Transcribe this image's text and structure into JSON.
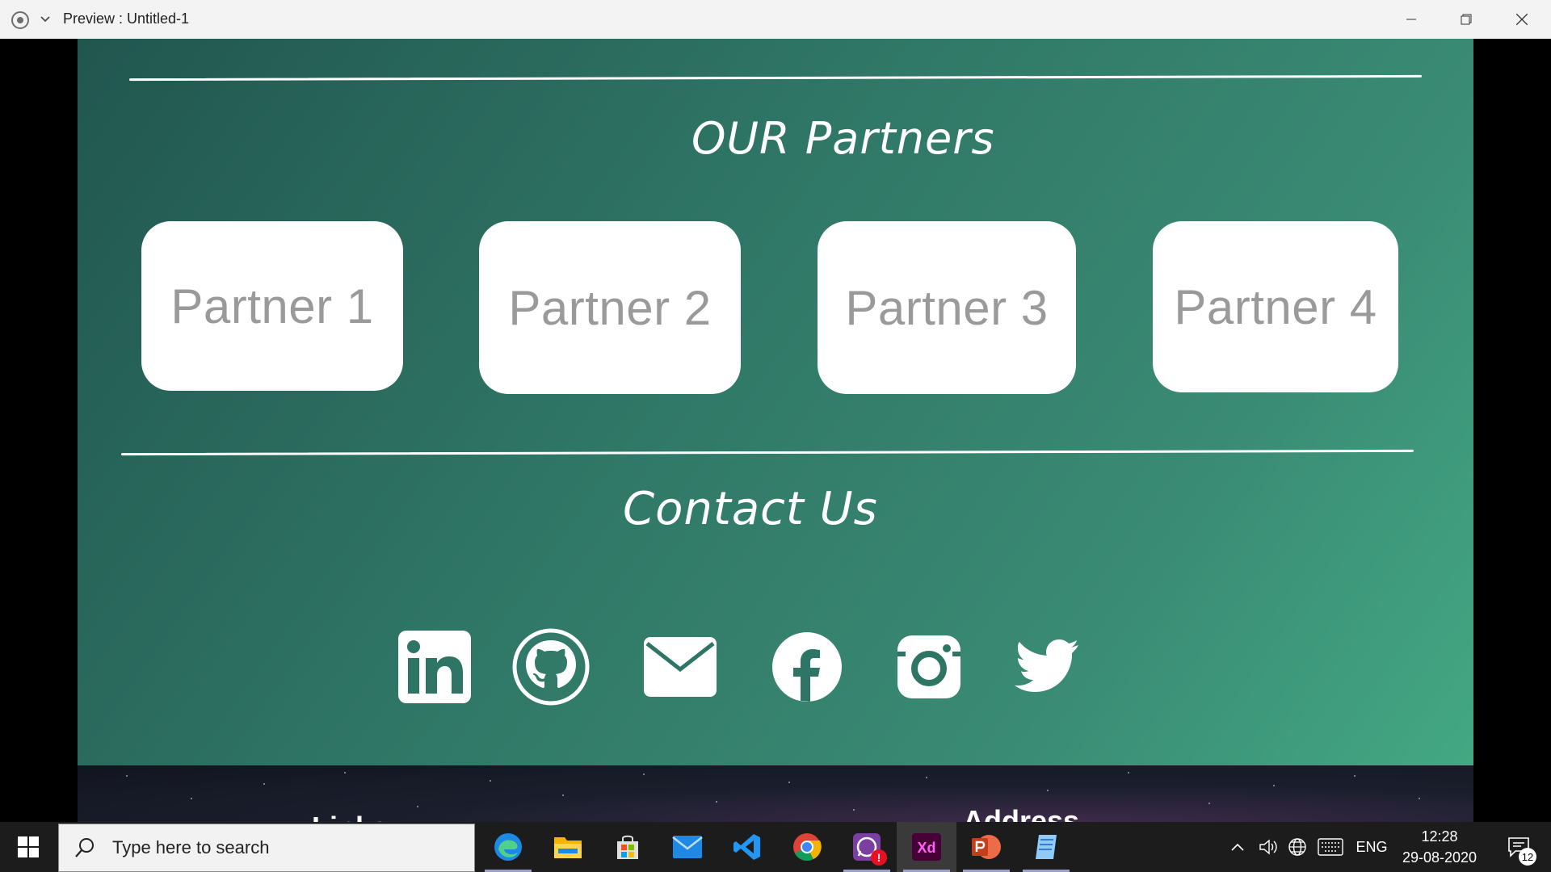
{
  "window": {
    "title": "Preview : Untitled-1"
  },
  "page": {
    "partners_title": "OUR Partners",
    "partners": [
      {
        "label": "Partner 1"
      },
      {
        "label": "Partner 2"
      },
      {
        "label": "Partner 3"
      },
      {
        "label": "Partner 4"
      }
    ],
    "contact_title": "Contact Us",
    "social_icons": [
      "linkedin-icon",
      "github-icon",
      "mail-icon",
      "facebook-icon",
      "instagram-icon",
      "twitter-icon"
    ],
    "footer": {
      "links_heading": "Links",
      "address_heading": "Address"
    },
    "colors": {
      "panel_gradient_start": "#21564f",
      "panel_gradient_end": "#43a883",
      "card_background": "#ffffff",
      "card_text": "#9a9a9a"
    }
  },
  "taskbar": {
    "search_placeholder": "Type here to search",
    "apps": [
      "edge-icon",
      "file-explorer-icon",
      "store-icon",
      "mail-app-icon",
      "vscode-icon",
      "chrome-icon",
      "whatsapp-icon",
      "adobe-xd-icon",
      "powerpoint-icon",
      "notepad-icon"
    ],
    "xd_label": "Xd",
    "language": "ENG",
    "time": "12:28",
    "date": "29-08-2020",
    "notification_count": "12",
    "whatsapp_alert": "!"
  }
}
